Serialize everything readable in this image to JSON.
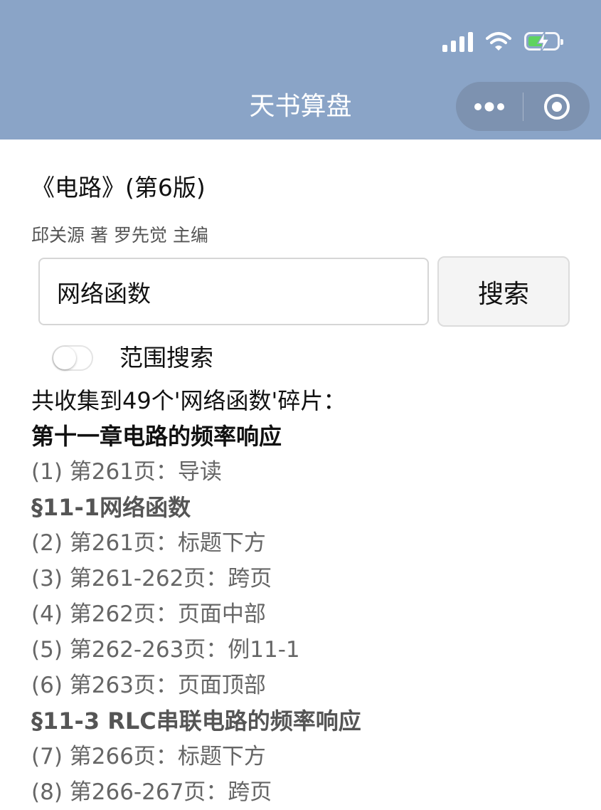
{
  "app": {
    "title": "天书算盘"
  },
  "colors": {
    "nav_background": "#8aa4c7",
    "battery_fill": "#5fd35f"
  },
  "status_icons": [
    "signal-icon",
    "wifi-icon",
    "battery-charging-icon"
  ],
  "capsule": {
    "icons": [
      "more-icon",
      "close-circle-icon"
    ]
  },
  "book": {
    "title": "《电路》(第6版)",
    "authors": "邱关源 著 罗先觉 主编"
  },
  "search": {
    "value": "网络函数",
    "button_label": "搜索"
  },
  "range_search": {
    "label": "范围搜索",
    "enabled": false
  },
  "results": {
    "summary": "共收集到49个'网络函数'碎片：",
    "lines": [
      {
        "type": "chapter",
        "text": "第十一章电路的频率响应"
      },
      {
        "type": "item",
        "text": "(1) 第261页：导读"
      },
      {
        "type": "section",
        "text": "§11-1网络函数"
      },
      {
        "type": "item",
        "text": "(2) 第261页：标题下方"
      },
      {
        "type": "item",
        "text": "(3) 第261-262页：跨页"
      },
      {
        "type": "item",
        "text": "(4) 第262页：页面中部"
      },
      {
        "type": "item",
        "text": "(5) 第262-263页：例11-1"
      },
      {
        "type": "item",
        "text": "(6) 第263页：页面顶部"
      },
      {
        "type": "section",
        "text": "§11-3 RLC串联电路的频率响应"
      },
      {
        "type": "item",
        "text": "(7) 第266页：标题下方"
      },
      {
        "type": "item",
        "text": "(8) 第266-267页：跨页"
      }
    ]
  }
}
